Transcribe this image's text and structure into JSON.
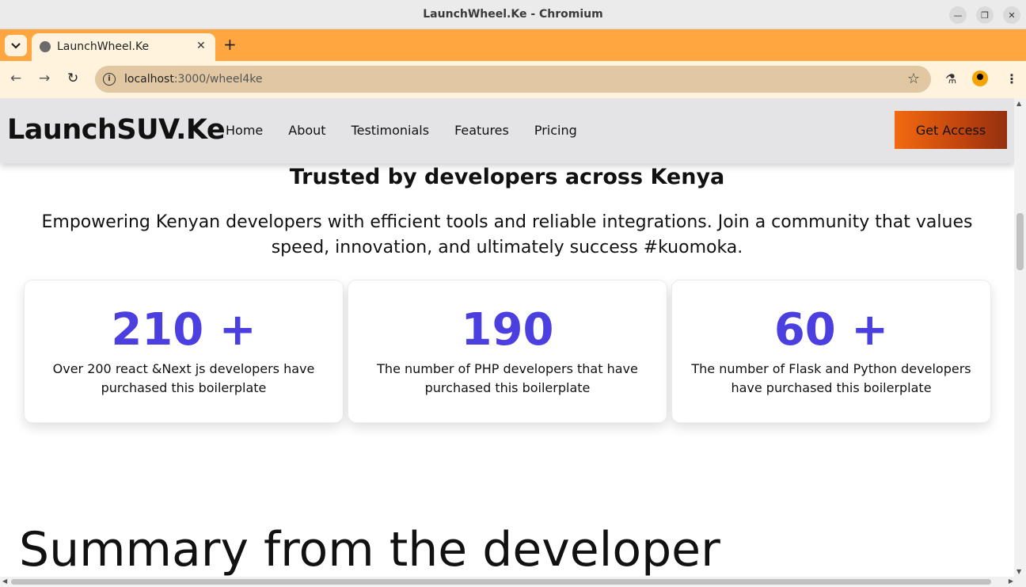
{
  "window": {
    "title": "LaunchWheel.Ke - Chromium"
  },
  "tab": {
    "title": "LaunchWheel.Ke"
  },
  "address_bar": {
    "host": "localhost",
    "path": ":3000/wheel4ke"
  },
  "site": {
    "brand": "LaunchSUV.Ke",
    "nav": [
      "Home",
      "About",
      "Testimonials",
      "Features",
      "Pricing"
    ],
    "cta_label": "Get Access"
  },
  "trust": {
    "heading": "Trusted by developers across Kenya",
    "subheading": "Empowering Kenyan developers with efficient tools and reliable integrations. Join a community that values speed, innovation, and ultimately success #kuomoka.",
    "stats": [
      {
        "value": "210 +",
        "description": "Over 200 react &Next js developers have purchased this boilerplate"
      },
      {
        "value": "190",
        "description": "The number of PHP developers that have purchased this boilerplate"
      },
      {
        "value": "60 +",
        "description": "The number of Flask and Python developers have purchased this boilerplate"
      }
    ]
  },
  "summary": {
    "heading": "Summary from the developer"
  },
  "colors": {
    "tab_strip": "#ffa640",
    "accent_number": "#4b3fe0",
    "cta_start": "#f26a10",
    "cta_end": "#93300f"
  },
  "icons": [
    "tab-list-icon",
    "globe-favicon-icon",
    "close-icon",
    "new-tab-icon",
    "back-icon",
    "forward-icon",
    "reload-icon",
    "site-info-icon",
    "bookmark-star-icon",
    "labs-flask-icon",
    "profile-icon",
    "kebab-menu-icon"
  ]
}
